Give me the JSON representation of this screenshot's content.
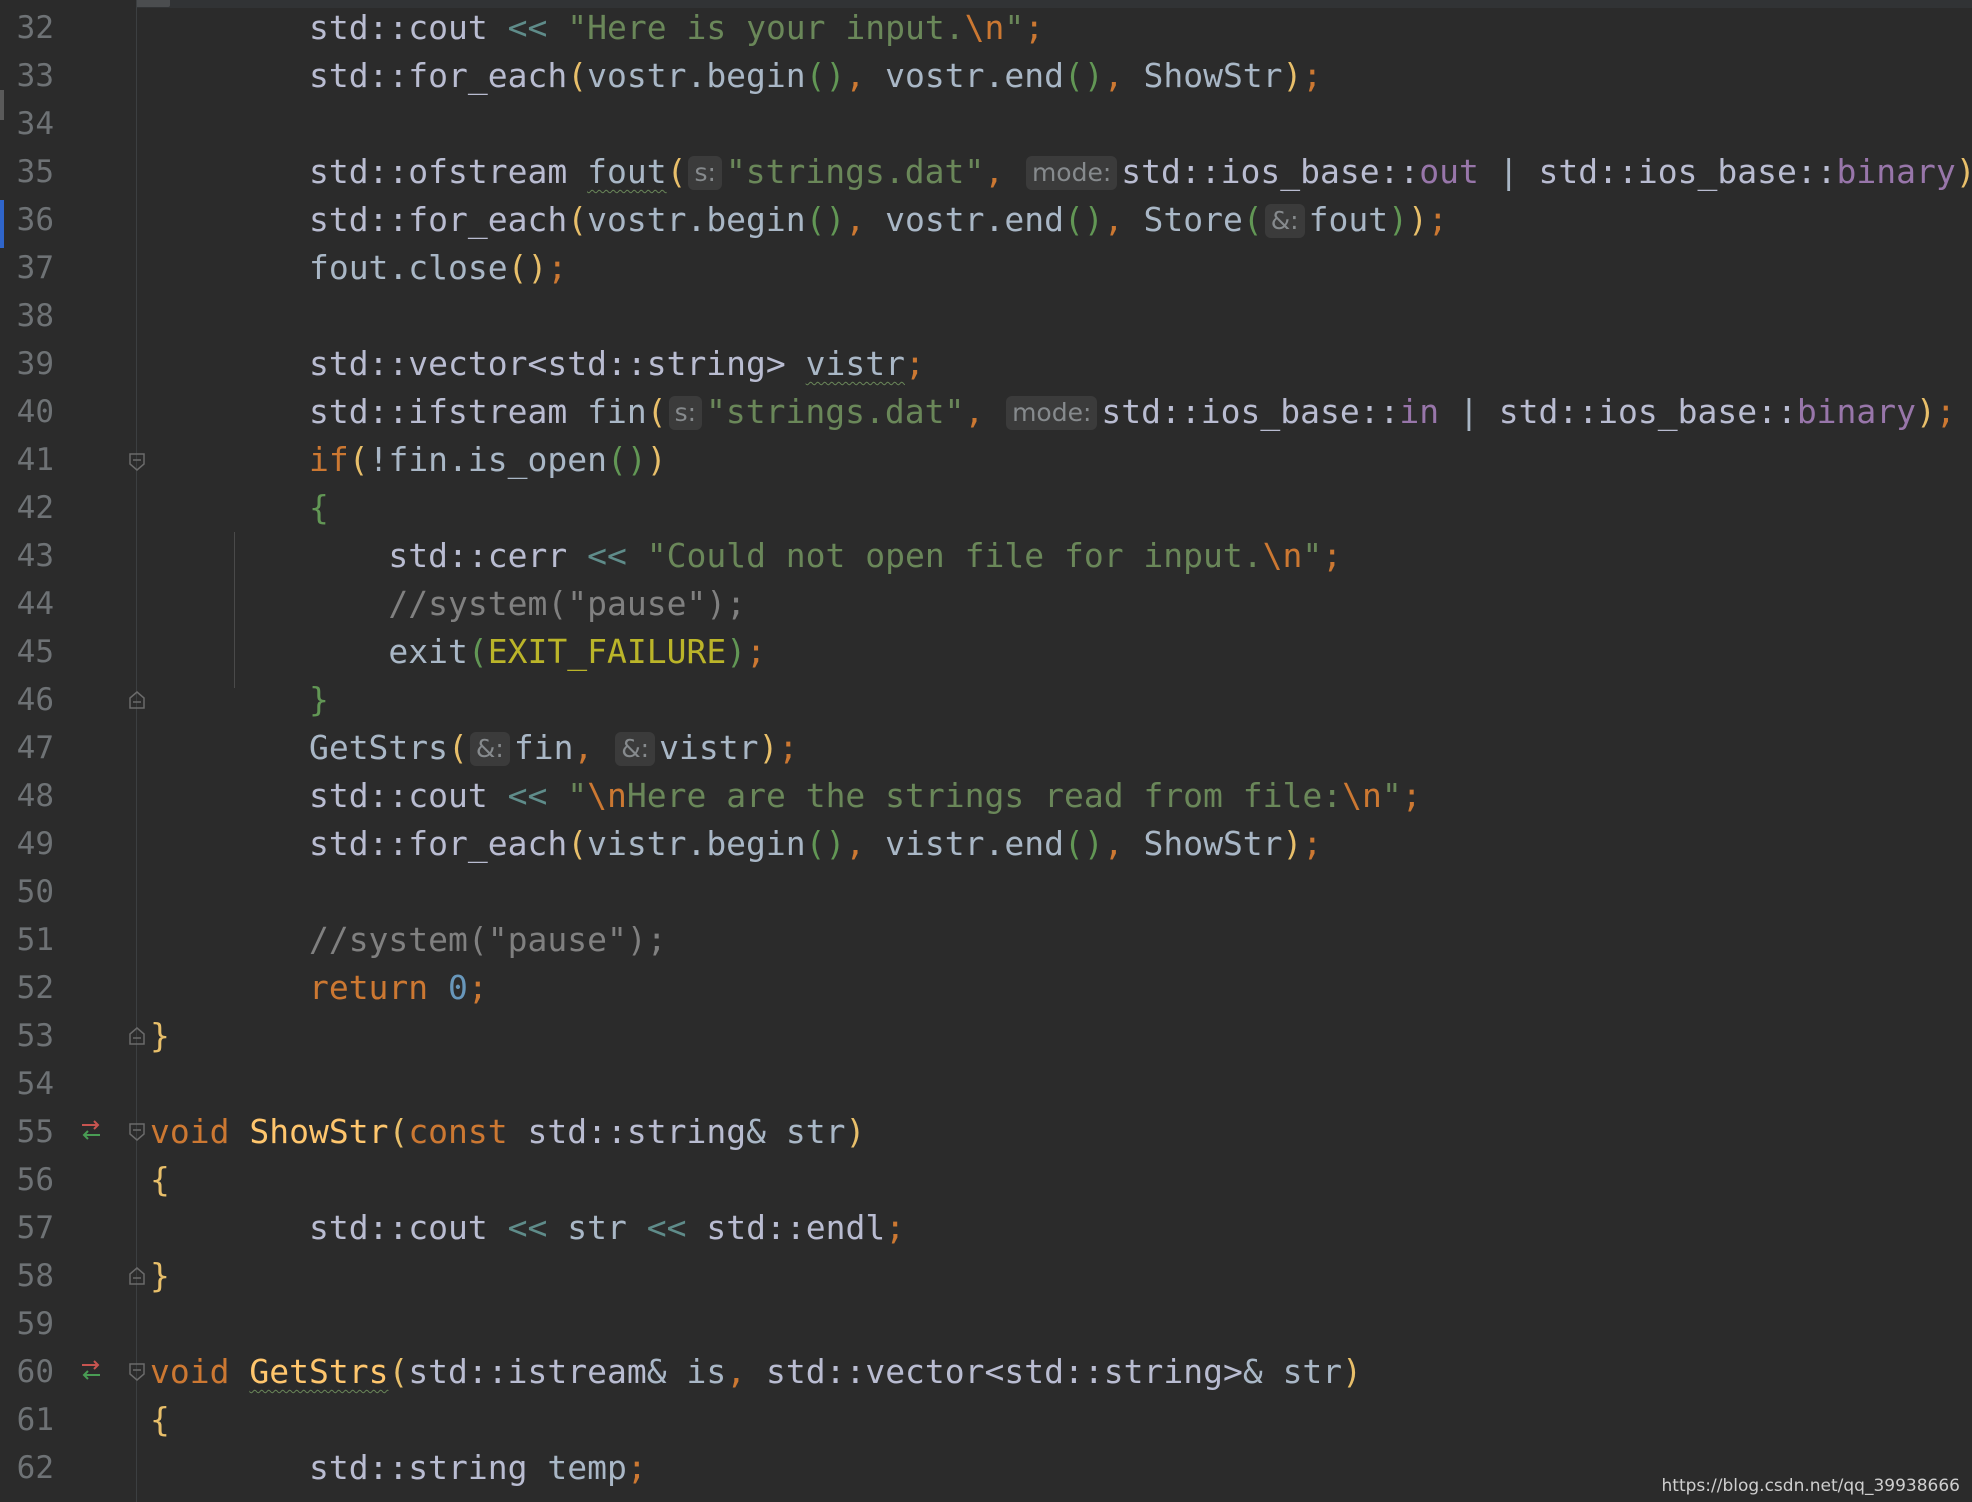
{
  "editor": {
    "watermark": "https://blog.csdn.net/qq_39938666",
    "line_numbers": [
      "32",
      "33",
      "34",
      "35",
      "36",
      "37",
      "38",
      "39",
      "40",
      "41",
      "42",
      "43",
      "44",
      "45",
      "46",
      "47",
      "48",
      "49",
      "50",
      "51",
      "52",
      "53",
      "54",
      "55",
      "56",
      "57",
      "58",
      "59",
      "60",
      "61",
      "62"
    ],
    "colors": {
      "background": "#2b2b2b",
      "string": "#6a8759",
      "keyword": "#cc7832",
      "function": "#ffc66d",
      "number": "#6897bb",
      "member": "#9876aa",
      "comment": "#808080"
    },
    "hints": {
      "s": "s:",
      "mode": "mode:",
      "ref": "&:"
    },
    "tokens": {
      "std_cout": "std::cout",
      "std_cerr": "std::cerr",
      "std_for_each": "std::for_each",
      "std_ofstream": "std::ofstream",
      "std_ifstream": "std::ifstream",
      "std_vector_string": "std::vector<std::string>",
      "std_vector": "std::vector",
      "std_string": "std::string",
      "std_istream": "std::istream",
      "std_endl": "std::endl",
      "ios_base": "std::ios_base::",
      "out": "out",
      "in": "in",
      "binary": "binary",
      "shl": "<<",
      "pipe": "|",
      "str_input": "\"Here is your input.",
      "str_file": "\"strings.dat\"",
      "str_err": "\"Could not open file for input.",
      "str_read": "Here are the strings read from file:",
      "esc_n": "\\n",
      "quote": "\"",
      "vostr_begin": "vostr.begin",
      "vostr_end": "vostr.end",
      "vistr_begin": "vistr.begin",
      "vistr_end": "vistr.end",
      "showstr": "ShowStr",
      "store": "Store",
      "fout": "fout",
      "fout_close": "fout.close",
      "fin": "fin",
      "vistr": "vistr",
      "if_kw": "if",
      "not_fin_open": "!fin.is_open",
      "brace_open": "{",
      "brace_close": "}",
      "comment_pause": "//system(\"pause\");",
      "exit": "exit",
      "exit_failure": "EXIT_FAILURE",
      "getstrs": "GetStrs",
      "return_kw": "return",
      "zero": "0",
      "void_kw": "void",
      "const_kw": "const",
      "str": "str",
      "is": "is",
      "temp": "temp"
    }
  }
}
